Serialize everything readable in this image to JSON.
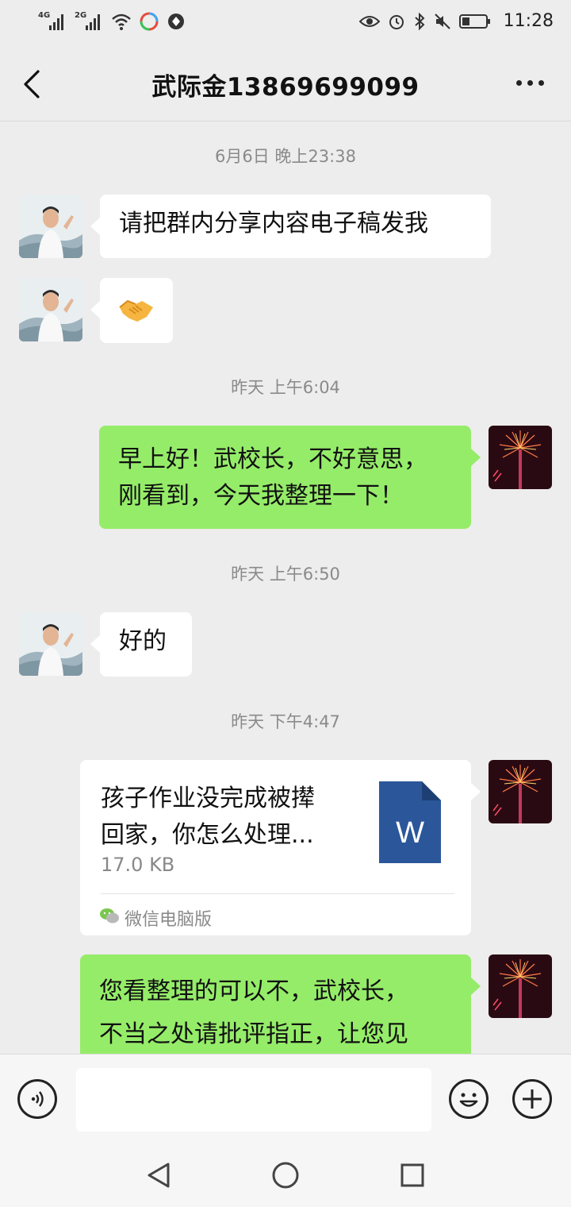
{
  "status_bar": {
    "signal_1_label": "4G",
    "signal_2_label": "2G",
    "time": "11:28"
  },
  "header": {
    "title": "武际金13869699099"
  },
  "messages": [
    {
      "type": "timestamp",
      "text": "6月6日 晚上23:38"
    },
    {
      "type": "text",
      "side": "in",
      "text": "请把群内分享内容电子稿发我"
    },
    {
      "type": "emoji",
      "side": "in",
      "emoji": "🤝"
    },
    {
      "type": "timestamp",
      "text": "昨天 上午6:04"
    },
    {
      "type": "text",
      "side": "out",
      "lines": [
        "早上好！武校长，不好意思，",
        "刚看到，今天我整理一下！"
      ]
    },
    {
      "type": "timestamp",
      "text": "昨天 上午6:50"
    },
    {
      "type": "text",
      "side": "in",
      "text": "好的"
    },
    {
      "type": "timestamp",
      "text": "昨天 下午4:47"
    },
    {
      "type": "file",
      "side": "out",
      "name_lines": [
        "孩子作业没完成被撵",
        "回家，你怎么处理..."
      ],
      "size": "17.0 KB",
      "file_icon_letter": "W",
      "source": "微信电脑版"
    },
    {
      "type": "text",
      "side": "out",
      "lines": [
        "您看整理的可以不，武校长，",
        "不当之处请批评指正，让您见"
      ]
    }
  ],
  "colors": {
    "background": "#ededed",
    "incoming_bubble": "#ffffff",
    "outgoing_bubble": "#95ec69",
    "word_icon": "#2b579a"
  },
  "icons": {
    "back": "chevron-left-icon",
    "more": "more-dots-icon",
    "voice": "voice-icon",
    "emoji": "smiley-icon",
    "plus": "plus-icon",
    "nav_back": "triangle-back-icon",
    "nav_home": "circle-home-icon",
    "nav_recent": "square-recents-icon"
  }
}
